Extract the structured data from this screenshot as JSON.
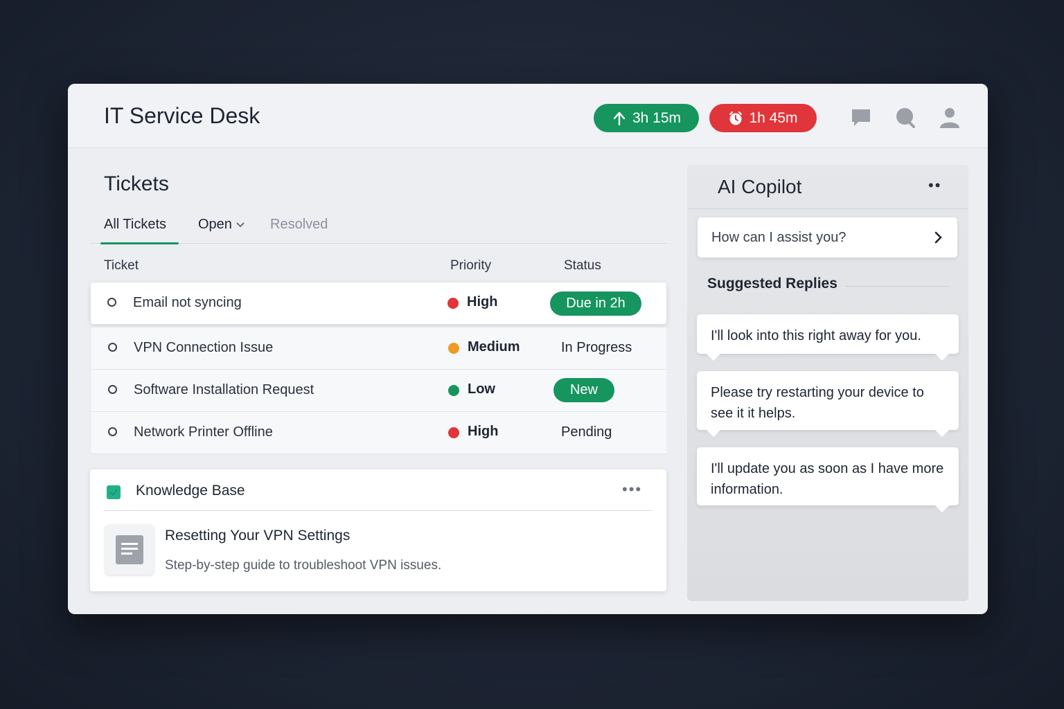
{
  "app": {
    "title": "IT Service Desk"
  },
  "header": {
    "timers": [
      {
        "label": "3h 15m",
        "icon": "arrow-up-icon",
        "color": "#16955f"
      },
      {
        "label": "1h 45m",
        "icon": "alarm-clock-icon",
        "color": "#e0353a"
      }
    ],
    "icons": [
      "chat-icon",
      "search-icon",
      "user-icon"
    ]
  },
  "tickets": {
    "title": "Tickets",
    "tabs": [
      {
        "label": "All Tickets",
        "active": true
      },
      {
        "label": "Open",
        "dropdown": true
      },
      {
        "label": "Resolved"
      }
    ],
    "columns": [
      "Ticket",
      "Priority",
      "Status"
    ],
    "rows": [
      {
        "name": "Email not syncing",
        "priority": "High",
        "priority_color": "#e0353a",
        "status": "Due in 2h",
        "status_style": "pill",
        "selected": true
      },
      {
        "name": "VPN Connection Issue",
        "priority": "Medium",
        "priority_color": "#f09a24",
        "status": "In Progress",
        "status_style": "text"
      },
      {
        "name": "Software Installation Request",
        "priority": "Low",
        "priority_color": "#16955f",
        "status": "New",
        "status_style": "pill"
      },
      {
        "name": "Network Printer Offline",
        "priority": "High",
        "priority_color": "#e0353a",
        "status": "Pending",
        "status_style": "text"
      }
    ]
  },
  "knowledge_base": {
    "title": "Knowledge Base",
    "article": {
      "title": "Resetting Your VPN Settings",
      "description": "Step-by-step guide to troubleshoot VPN issues."
    }
  },
  "copilot": {
    "title": "AI Copilot",
    "prompt_placeholder": "How can I assist you?",
    "suggested_label": "Suggested Replies",
    "replies": [
      "I'll look into this right away for you.",
      "Please try restarting your device to see it it helps.",
      "I'll update you as soon as I have more information."
    ]
  }
}
